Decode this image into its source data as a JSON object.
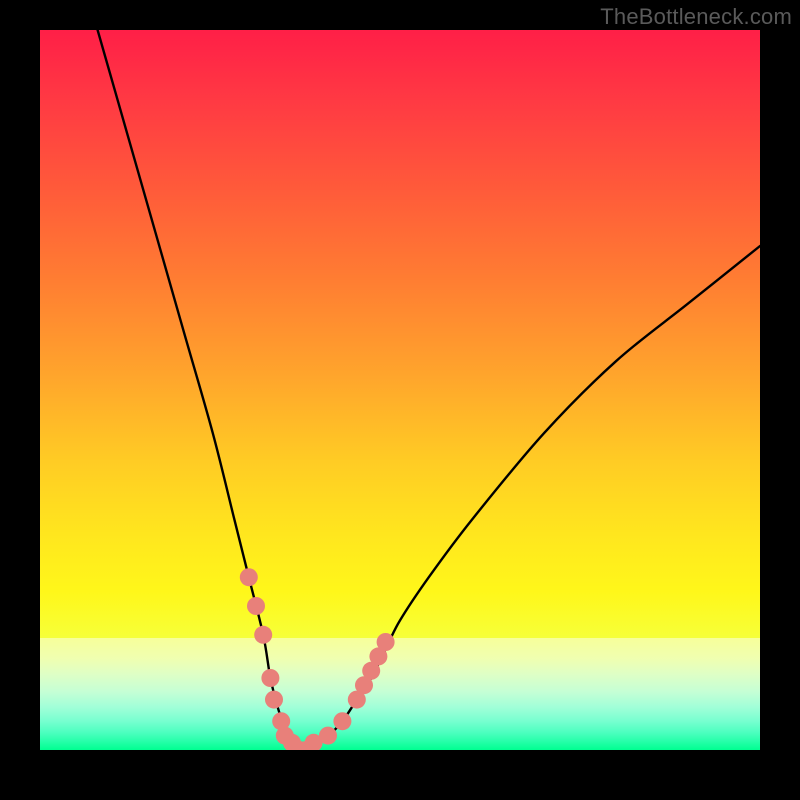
{
  "watermark": "TheBottleneck.com",
  "chart_data": {
    "type": "line",
    "title": "",
    "xlabel": "",
    "ylabel": "",
    "xlim": [
      0,
      100
    ],
    "ylim": [
      0,
      100
    ],
    "x": [
      8,
      12,
      16,
      20,
      24,
      27,
      29,
      31,
      32,
      33,
      34,
      35,
      36,
      37,
      38,
      40,
      42,
      44,
      46,
      48,
      50,
      54,
      60,
      70,
      80,
      90,
      100
    ],
    "values": [
      100,
      86,
      72,
      58,
      44,
      32,
      24,
      16,
      10,
      6,
      3,
      1,
      0,
      0,
      1,
      2,
      4,
      7,
      10,
      14,
      18,
      24,
      32,
      44,
      54,
      62,
      70
    ],
    "marker_points_x": [
      29,
      30,
      31,
      32,
      32.5,
      33.5,
      34,
      35,
      36,
      37,
      38,
      40,
      42,
      44,
      45,
      46,
      47,
      48
    ],
    "marker_points_y": [
      24,
      20,
      16,
      10,
      7,
      4,
      2,
      1,
      0,
      0,
      1,
      2,
      4,
      7,
      9,
      11,
      13,
      15
    ],
    "marker_color": "#e8807a",
    "marker_radius": 9,
    "gradient_stops": [
      {
        "offset": 0.0,
        "color": "#ff1f47"
      },
      {
        "offset": 0.1,
        "color": "#ff3a43"
      },
      {
        "offset": 0.22,
        "color": "#ff5a3a"
      },
      {
        "offset": 0.35,
        "color": "#ff7e32"
      },
      {
        "offset": 0.48,
        "color": "#ffa52c"
      },
      {
        "offset": 0.6,
        "color": "#ffcc24"
      },
      {
        "offset": 0.7,
        "color": "#ffe61e"
      },
      {
        "offset": 0.78,
        "color": "#fff71a"
      },
      {
        "offset": 0.84,
        "color": "#f7ff36"
      },
      {
        "offset": 0.88,
        "color": "#e0ff6a"
      },
      {
        "offset": 0.92,
        "color": "#b8ffb0"
      },
      {
        "offset": 0.95,
        "color": "#7fffd0"
      },
      {
        "offset": 0.975,
        "color": "#3effc2"
      },
      {
        "offset": 1.0,
        "color": "#00ff91"
      }
    ],
    "band_stops": [
      {
        "offset": 0.0,
        "color": "#f7ff9a"
      },
      {
        "offset": 0.18,
        "color": "#f0ffb0"
      },
      {
        "offset": 0.32,
        "color": "#dfffc5"
      },
      {
        "offset": 0.48,
        "color": "#c5ffd5"
      },
      {
        "offset": 0.62,
        "color": "#a0ffd8"
      },
      {
        "offset": 0.74,
        "color": "#78ffd0"
      },
      {
        "offset": 0.84,
        "color": "#4effc0"
      },
      {
        "offset": 0.92,
        "color": "#28ffaa"
      },
      {
        "offset": 1.0,
        "color": "#00ff91"
      }
    ]
  }
}
